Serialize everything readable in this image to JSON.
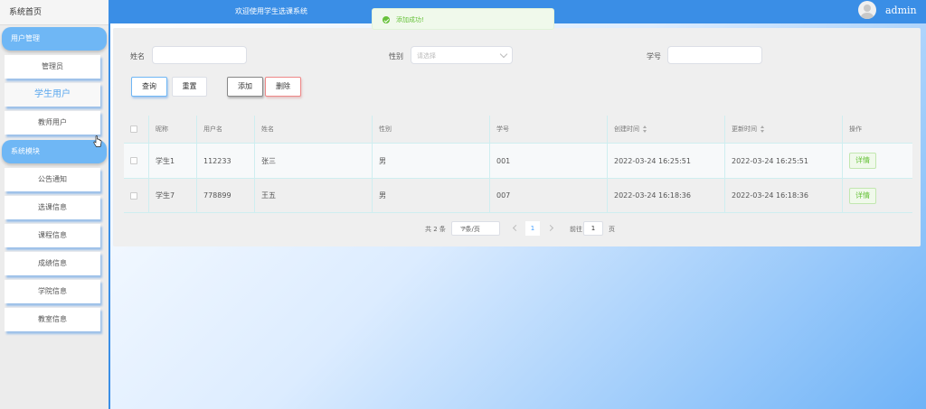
{
  "header": {
    "title": "欢迎使用学生选课系统",
    "username": "admin"
  },
  "toast": {
    "message": "添加成功!"
  },
  "sidebar": {
    "home": "系统首页",
    "groups": [
      {
        "label": "用户管理",
        "items": [
          "管理员",
          "学生用户",
          "教师用户"
        ]
      },
      {
        "label": "系统模块",
        "items": [
          "公告通知",
          "选课信息",
          "课程信息",
          "成绩信息",
          "学院信息",
          "教室信息"
        ]
      }
    ],
    "active_item": "学生用户"
  },
  "search": {
    "name_label": "姓名",
    "name_value": "",
    "gender_label": "性别",
    "gender_placeholder": "请选择",
    "student_no_label": "学号",
    "student_no_value": ""
  },
  "buttons": {
    "query": "查询",
    "reset": "重置",
    "add": "添加",
    "delete": "删除"
  },
  "table": {
    "headers": [
      "昵称",
      "用户名",
      "姓名",
      "性别",
      "学号",
      "创建时间",
      "更新时间",
      "操作"
    ],
    "rows": [
      {
        "nickname": "学生1",
        "username": "112233",
        "name": "张三",
        "gender": "男",
        "student_no": "001",
        "created": "2022-03-24 16:25:51",
        "updated": "2022-03-24 16:25:51",
        "action": "详情"
      },
      {
        "nickname": "学生7",
        "username": "778899",
        "name": "王五",
        "gender": "男",
        "student_no": "007",
        "created": "2022-03-24 16:18:36",
        "updated": "2022-03-24 16:18:36",
        "action": "详情"
      }
    ]
  },
  "pagination": {
    "total": "共 2 条",
    "page_size": "7条/页",
    "current_page": "1",
    "goto_label": "前往",
    "goto_value": "1",
    "page_suffix": "页"
  },
  "colors": {
    "primary": "#3a8ee6",
    "success": "#67c23a",
    "sidebar_group": "#6fb7f5"
  }
}
